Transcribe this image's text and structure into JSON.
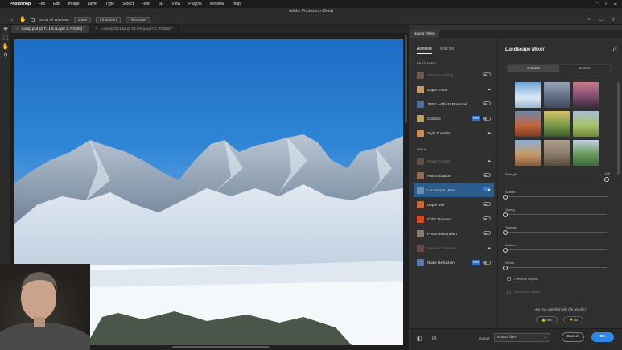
{
  "menubar": {
    "app": "Photoshop",
    "items": [
      "File",
      "Edit",
      "Image",
      "Layer",
      "Type",
      "Select",
      "Filter",
      "3D",
      "View",
      "Plugins",
      "Window",
      "Help"
    ]
  },
  "window": {
    "title": "Adobe Photoshop (Beta)"
  },
  "options": {
    "scroll_all_windows": "Scroll All Windows",
    "zoom_100": "100%",
    "fit_screen": "Fit Screen",
    "fill_screen": "Fill Screen"
  },
  "documents": [
    {
      "label": "Comp.psd @ 77.1% (Layer 3, RGB/8) *",
      "active": true
    },
    {
      "label": "LookingOut.psd @ 63.5% (Layer 0, RGB/8) *",
      "active": false
    }
  ],
  "neural_filters": {
    "panel_tab": "Neural Filters",
    "tabs": {
      "all": "All filters",
      "wait": "Wait list"
    },
    "featured_label": "FEATURED",
    "beta_label": "BETA",
    "featured": [
      {
        "name": "Skin Smoothing",
        "control": "toggle",
        "dim": true,
        "thumb": "#b88a74"
      },
      {
        "name": "Super Zoom",
        "control": "cloud",
        "dim": false,
        "thumb": "#c79a6a"
      },
      {
        "name": "JPEG Artifacts Removal",
        "control": "toggle",
        "dim": false,
        "thumb": "#4a6e9a"
      },
      {
        "name": "Colorize",
        "control": "toggle",
        "badge": "New",
        "dim": false,
        "thumb": "#b9a069"
      },
      {
        "name": "Style Transfer",
        "control": "cloud",
        "dim": false,
        "thumb": "#c98a5a"
      }
    ],
    "beta": [
      {
        "name": "Smart Portrait",
        "control": "cloud",
        "dim": true,
        "thumb": "#9a7a66"
      },
      {
        "name": "Harmonization",
        "control": "toggle",
        "dim": false,
        "thumb": "#8e6e5a"
      },
      {
        "name": "Landscape Mixer",
        "control": "toggle-on",
        "active": true,
        "dim": false,
        "thumb": "#6b8fb3"
      },
      {
        "name": "Depth Blur",
        "control": "toggle",
        "dim": false,
        "thumb": "#c26a3a"
      },
      {
        "name": "Color Transfer",
        "control": "toggle",
        "dim": false,
        "thumb": "#d24a2a"
      },
      {
        "name": "Photo Restoration",
        "control": "toggle",
        "dim": false,
        "thumb": "#8a7a6a"
      },
      {
        "name": "Makeup Transfer",
        "control": "cloud",
        "dim": true,
        "thumb": "#a86a6a"
      },
      {
        "name": "Noise Reduction",
        "control": "toggle",
        "badge": "New",
        "dim": false,
        "thumb": "#5a7aa0"
      }
    ]
  },
  "settings": {
    "title": "Landscape Mixer",
    "presets_tab": "Presets",
    "custom_tab": "Custom",
    "presets": [
      "#6fa3d9",
      "#7a8aa6",
      "#c77a8a",
      "#c2643a",
      "#7a9a4a",
      "#a8c06a",
      "#c89a6a",
      "#8a7a6a",
      "#6a9a5a"
    ],
    "sliders": [
      {
        "label": "Strength",
        "value": 100,
        "value_text": "100"
      },
      {
        "label": "Sunset",
        "value": 0
      },
      {
        "label": "Spring",
        "value": 0
      },
      {
        "label": "Summer",
        "value": 0
      },
      {
        "label": "Autumn",
        "value": 0
      },
      {
        "label": "Winter",
        "value": 0
      }
    ],
    "preserve_subject": "Preserve subject",
    "harmonize_subject": "Harmonize subject",
    "question": "Are you satisfied with the results?",
    "yes": "Yes",
    "no": "No"
  },
  "bottom": {
    "output_label": "Output",
    "output_value": "Smart filter",
    "cancel": "Cancel",
    "ok": "OK"
  }
}
